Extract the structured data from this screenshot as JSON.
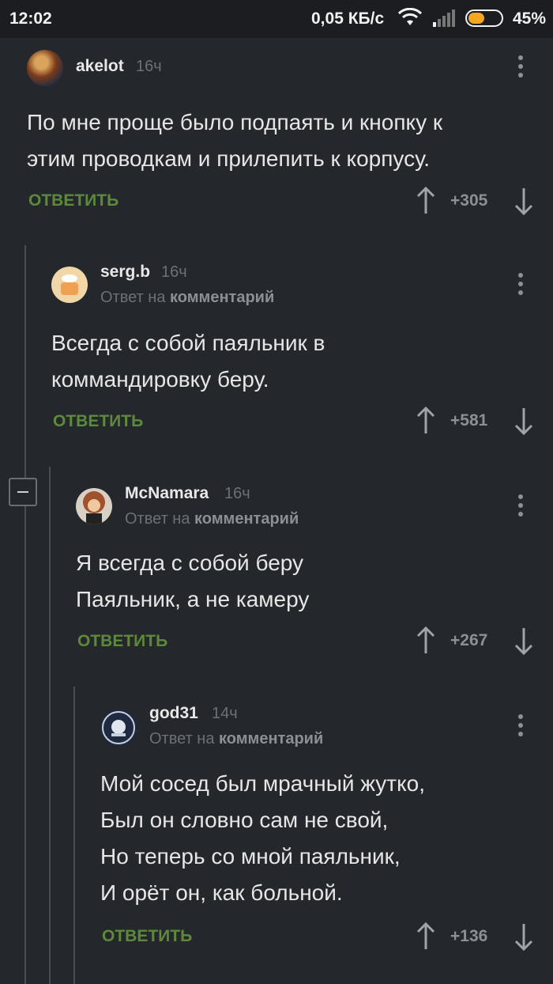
{
  "status_bar": {
    "time": "12:02",
    "network_speed": "0,05 КБ/с",
    "battery": "45%",
    "battery_level": 0.45
  },
  "reply_prefix": "Ответ на",
  "reply_target": "комментарий",
  "comments": [
    {
      "author": "akelot",
      "time": "16ч",
      "text": "По мне проще было подпаять и кнопку к\nэтим проводкам и прилепить к корпусу.",
      "reply_label": "ОТВЕТИТЬ",
      "score": "+305"
    },
    {
      "author": "serg.b",
      "time": "16ч",
      "text": "Всегда с собой паяльник в\nкоммандировку беру.",
      "reply_label": "ОТВЕТИТЬ",
      "score": "+581"
    },
    {
      "author": "McNamara",
      "time": "16ч",
      "text": "Я всегда с собой беру\nПаяльник, а не камеру",
      "reply_label": "ОТВЕТИТЬ",
      "score": "+267"
    },
    {
      "author": "god31",
      "time": "14ч",
      "text": "Мой сосед был мрачный жутко,\nБыл он словно сам не свой,\nНо теперь со мной паяльник,\nИ орёт он, как больной.",
      "reply_label": "ОТВЕТИТЬ",
      "score": "+136"
    }
  ],
  "colors": {
    "background": "#24272b",
    "reply_green": "#5d8a3a",
    "battery_orange": "#f5a623"
  }
}
